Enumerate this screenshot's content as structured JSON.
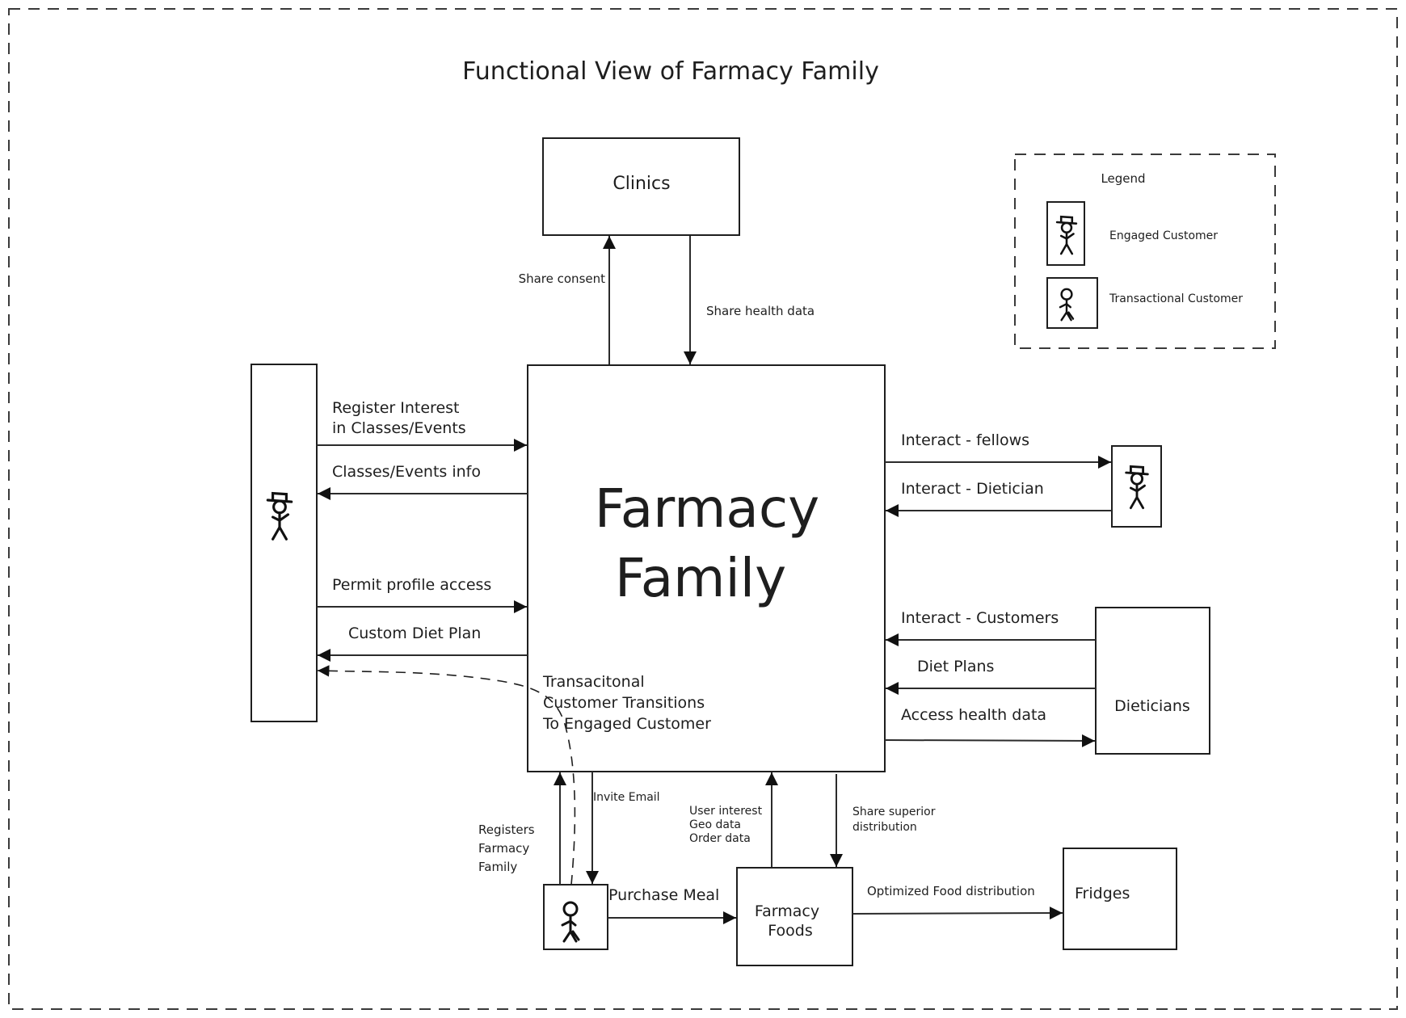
{
  "diagram": {
    "title": "Functional View of Farmacy Family",
    "central_node": {
      "line1": "Farmacy",
      "line2": "Family"
    },
    "nodes": {
      "clinics": "Clinics",
      "dieticians": "Dieticians",
      "farmacy_foods": {
        "line1": "Farmacy",
        "line2": "Foods"
      },
      "fridges": "Fridges",
      "engaged_customer_left": {
        "icon": "engaged-customer-icon"
      },
      "engaged_customer_right": {
        "icon": "engaged-customer-icon"
      },
      "transactional_customer": {
        "icon": "transactional-customer-icon"
      }
    },
    "legend": {
      "title": "Legend",
      "items": [
        {
          "icon": "engaged-customer-icon",
          "label": "Engaged Customer"
        },
        {
          "icon": "transactional-customer-icon",
          "label": "Transactional Customer"
        }
      ]
    },
    "edges": {
      "share_consent": "Share consent",
      "share_health_data": "Share health data",
      "register_interest": {
        "line1": "Register Interest",
        "line2": "in Classes/Events"
      },
      "classes_events_info": "Classes/Events info",
      "permit_profile_access": "Permit profile access",
      "custom_diet_plan": "Custom Diet Plan",
      "interact_fellows": "Interact - fellows",
      "interact_dietician": "Interact - Dietician",
      "interact_customers": "Interact - Customers",
      "diet_plans": "Diet Plans",
      "access_health_data": "Access health data",
      "transition_note": {
        "line1": "Transacitonal",
        "line2": "Customer Transitions",
        "line3": "To Engaged Customer"
      },
      "invite_email": "Invite Email",
      "registers": {
        "line1": "Registers",
        "line2": "Farmacy",
        "line3": "Family"
      },
      "user_data": {
        "line1": "User interest",
        "line2": "Geo data",
        "line3": "Order data"
      },
      "share_distribution": {
        "line1": "Share superior",
        "line2": "distribution"
      },
      "purchase_meal": "Purchase Meal",
      "optimized_distribution": "Optimized Food distribution"
    }
  }
}
